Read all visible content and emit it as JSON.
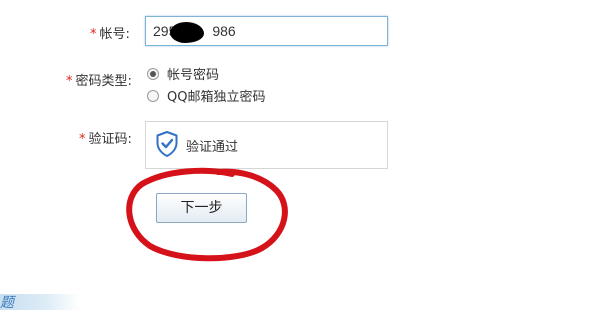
{
  "form": {
    "account": {
      "label": "帐号:",
      "value_prefix": "295",
      "value_suffix": "986"
    },
    "password_type": {
      "label": "密码类型:",
      "options": [
        {
          "label": "帐号密码",
          "selected": true
        },
        {
          "label": "QQ邮箱独立密码",
          "selected": false
        }
      ]
    },
    "captcha": {
      "label": "验证码:",
      "status": "验证通过",
      "icon": "shield-check-icon"
    },
    "next_button": "下一步",
    "required_marker": "*"
  },
  "footer": {
    "partial_text": "题"
  },
  "colors": {
    "required": "#e2231a",
    "focus_border": "#7fb4d6",
    "annotation_circle": "#d5121a",
    "shield": "#2f73c2"
  }
}
